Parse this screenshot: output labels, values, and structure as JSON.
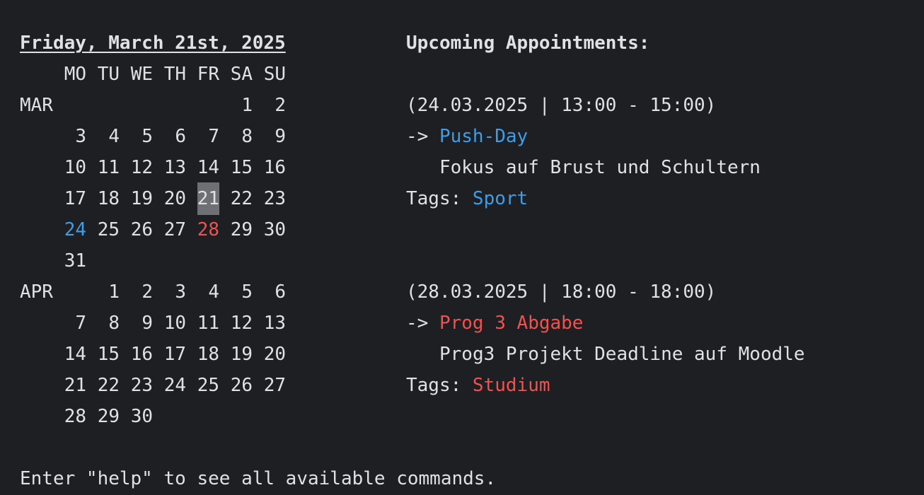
{
  "header": {
    "date_title": "Friday, March 21st, 2025",
    "upcoming_label": "Upcoming Appointments:"
  },
  "calendar": {
    "weekdays": [
      "MO",
      "TU",
      "WE",
      "TH",
      "FR",
      "SA",
      "SU"
    ],
    "months": [
      {
        "name": "MAR",
        "weeks": [
          [
            "",
            "",
            "",
            "",
            "",
            "1",
            "2"
          ],
          [
            "3",
            "4",
            "5",
            "6",
            "7",
            "8",
            "9"
          ],
          [
            "10",
            "11",
            "12",
            "13",
            "14",
            "15",
            "16"
          ],
          [
            "17",
            "18",
            "19",
            "20",
            "21",
            "22",
            "23"
          ],
          [
            "24",
            "25",
            "26",
            "27",
            "28",
            "29",
            "30"
          ],
          [
            "31",
            "",
            "",
            "",
            "",
            "",
            ""
          ]
        ]
      },
      {
        "name": "APR",
        "weeks": [
          [
            "",
            "1",
            "2",
            "3",
            "4",
            "5",
            "6"
          ],
          [
            "7",
            "8",
            "9",
            "10",
            "11",
            "12",
            "13"
          ],
          [
            "14",
            "15",
            "16",
            "17",
            "18",
            "19",
            "20"
          ],
          [
            "21",
            "22",
            "23",
            "24",
            "25",
            "26",
            "27"
          ],
          [
            "28",
            "29",
            "30",
            "",
            "",
            "",
            ""
          ]
        ]
      }
    ],
    "today": {
      "month": "MAR",
      "day": "21",
      "highlight_color": "#6f7075"
    },
    "marked_days": [
      {
        "month": "MAR",
        "day": "24",
        "color": "#3d9ee8"
      },
      {
        "month": "MAR",
        "day": "28",
        "color": "#f0524f"
      }
    ]
  },
  "appointments": [
    {
      "when": "(24.03.2025 | 13:00 - 15:00)",
      "arrow": "-> ",
      "title": "Push-Day",
      "title_color": "#3d9ee8",
      "description": "Fokus auf Brust und Schultern",
      "tags_label": "Tags: ",
      "tag": "Sport",
      "tag_color": "#3d9ee8"
    },
    {
      "when": "(28.03.2025 | 18:00 - 18:00)",
      "arrow": "-> ",
      "title": "Prog 3 Abgabe",
      "title_color": "#f0524f",
      "description": "Prog3 Projekt Deadline auf Moodle",
      "tags_label": "Tags: ",
      "tag": "Studium",
      "tag_color": "#f0524f"
    }
  ],
  "footer": {
    "hint": "Enter \"help\" to see all available commands."
  },
  "colors": {
    "background": "#1e1f22",
    "foreground": "#dfe1e5",
    "blue": "#3d9ee8",
    "red": "#f0524f"
  }
}
